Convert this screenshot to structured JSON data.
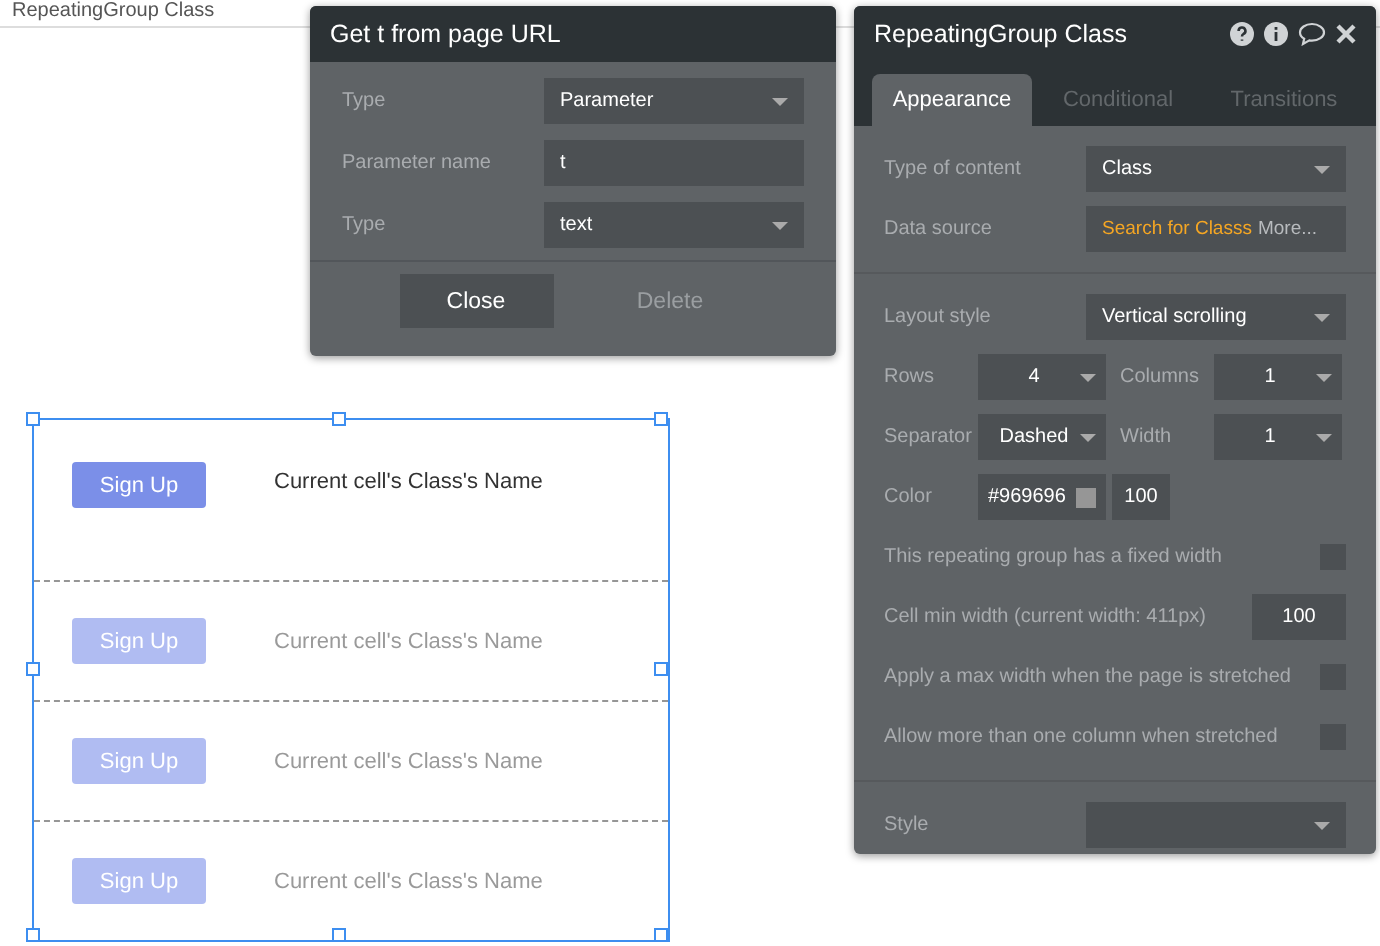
{
  "top_bar": {
    "title": "RepeatingGroup Class"
  },
  "url_dialog": {
    "title": "Get t from page URL",
    "fields": [
      {
        "kind": "select",
        "label": "Type",
        "value": "Parameter"
      },
      {
        "kind": "input",
        "label": "Parameter name",
        "value": "t"
      },
      {
        "kind": "select",
        "label": "Type",
        "value": "text"
      }
    ],
    "buttons": [
      {
        "label": "Close",
        "disabled": false
      },
      {
        "label": "Delete",
        "disabled": true
      }
    ]
  },
  "properties": {
    "title": "RepeatingGroup Class",
    "tabs": [
      {
        "label": "Appearance",
        "selected": true
      },
      {
        "label": "Conditional",
        "selected": false
      },
      {
        "label": "Transitions",
        "selected": false
      }
    ],
    "sections": [
      [
        {
          "kind": "select",
          "label": "Type of content",
          "value": "Class"
        },
        {
          "kind": "source",
          "label": "Data source",
          "value": "Search for Classs",
          "more": "More..."
        }
      ],
      [
        {
          "kind": "select",
          "label": "Layout style",
          "value": "Vertical scrolling"
        },
        {
          "kind": "pair",
          "label": "Rows",
          "value": "4",
          "label_2": "Columns",
          "value_2": "1"
        },
        {
          "kind": "pair",
          "label": "Separator",
          "value": "Dashed",
          "label_2": "Width",
          "value_2": "1"
        },
        {
          "kind": "color",
          "label": "Color",
          "value": "#969696",
          "opacity": "100"
        },
        {
          "kind": "checkbox",
          "label": "This repeating group has a fixed width",
          "checked": false
        },
        {
          "kind": "number",
          "label": "Cell min width (current width: 411px)",
          "value": "100"
        },
        {
          "kind": "checkbox",
          "label": "Apply a max width when the page is stretched",
          "checked": false
        },
        {
          "kind": "checkbox",
          "label": "Allow more than one column when stretched",
          "checked": false
        }
      ],
      [
        {
          "kind": "select",
          "label": "Style"
        }
      ]
    ]
  },
  "repeating_group": {
    "cells": [
      {
        "button": "Sign Up",
        "text": "Current cell's Class's Name",
        "dimmed": false
      },
      {
        "button": "Sign Up",
        "text": "Current cell's Class's Name",
        "dimmed": true
      },
      {
        "button": "Sign Up",
        "text": "Current cell's Class's Name",
        "dimmed": true
      },
      {
        "button": "Sign Up",
        "text": "Current cell's Class's Name",
        "dimmed": true
      }
    ]
  }
}
